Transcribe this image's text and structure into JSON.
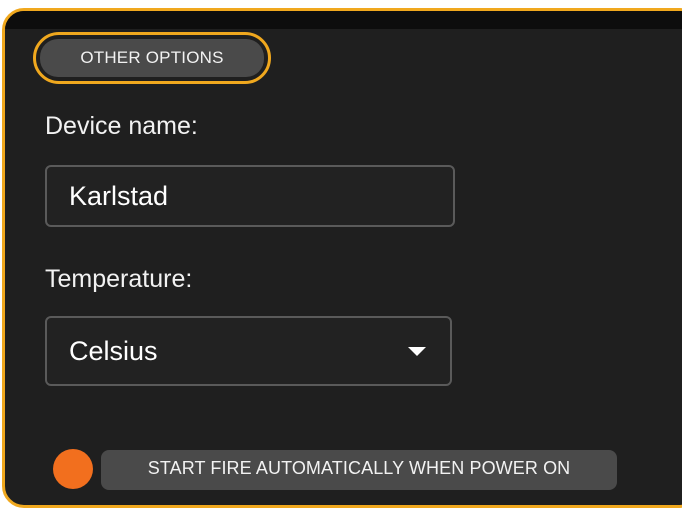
{
  "tab": {
    "label": "OTHER OPTIONS"
  },
  "device_name": {
    "label": "Device name:",
    "value": "Karlstad"
  },
  "temperature": {
    "label": "Temperature:",
    "selected": "Celsius"
  },
  "auto_fire": {
    "label": "START FIRE AUTOMATICALLY WHEN POWER ON"
  },
  "colors": {
    "accent": "#f0a81e",
    "panel_bg": "#1f1f1f",
    "toggle": "#f26f1e",
    "chip_bg": "#4a4a4a"
  },
  "icons": {
    "dropdown": "chevron-down-icon"
  }
}
